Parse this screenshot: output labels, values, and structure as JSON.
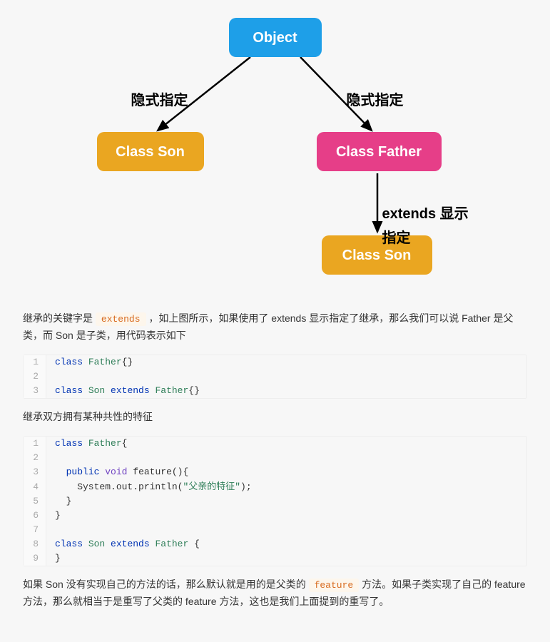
{
  "diagram": {
    "object_label": "Object",
    "son_label": "Class Son",
    "father_label": "Class Father",
    "implicit_label": "隐式指定",
    "extends_label": "extends 显示指定"
  },
  "para1_pre": "继承的关键字是 ",
  "para1_code": "extends",
  "para1_post": " ，如上图所示，如果使用了 extends 显示指定了继承，那么我们可以说 Father 是父类，而 Son 是子类，用代码表示如下",
  "code1": [
    {
      "n": "1",
      "html": "<span class='kw-class'>class</span> <span class='kw-name'>Father</span>{}"
    },
    {
      "n": "2",
      "html": ""
    },
    {
      "n": "3",
      "html": "<span class='kw-class'>class</span> <span class='kw-name'>Son</span> <span class='kw-class'>extends</span> <span class='kw-name'>Father</span>{}"
    }
  ],
  "para2": "继承双方拥有某种共性的特征",
  "code2": [
    {
      "n": "1",
      "html": "<span class='kw-class'>class</span> <span class='kw-name'>Father</span>{"
    },
    {
      "n": "2",
      "html": ""
    },
    {
      "n": "3",
      "html": "  <span class='kw-mod'>public</span> <span class='kw-type'>void</span> <span class='kw-call'>feature</span>(){"
    },
    {
      "n": "4",
      "html": "    System.out.println(<span class='kw-str'>\"父亲的特征\"</span>);"
    },
    {
      "n": "5",
      "html": "  }"
    },
    {
      "n": "6",
      "html": "}"
    },
    {
      "n": "7",
      "html": ""
    },
    {
      "n": "8",
      "html": "<span class='kw-class'>class</span> <span class='kw-name'>Son</span> <span class='kw-class'>extends</span> <span class='kw-name'>Father</span> {"
    },
    {
      "n": "9",
      "html": "}"
    }
  ],
  "para3_pre": "如果 Son 没有实现自己的方法的话，那么默认就是用的是父类的 ",
  "para3_code": "feature",
  "para3_post": " 方法。如果子类实现了自己的 feature 方法，那么就相当于是重写了父类的 feature 方法，这也是我们上面提到的重写了。"
}
